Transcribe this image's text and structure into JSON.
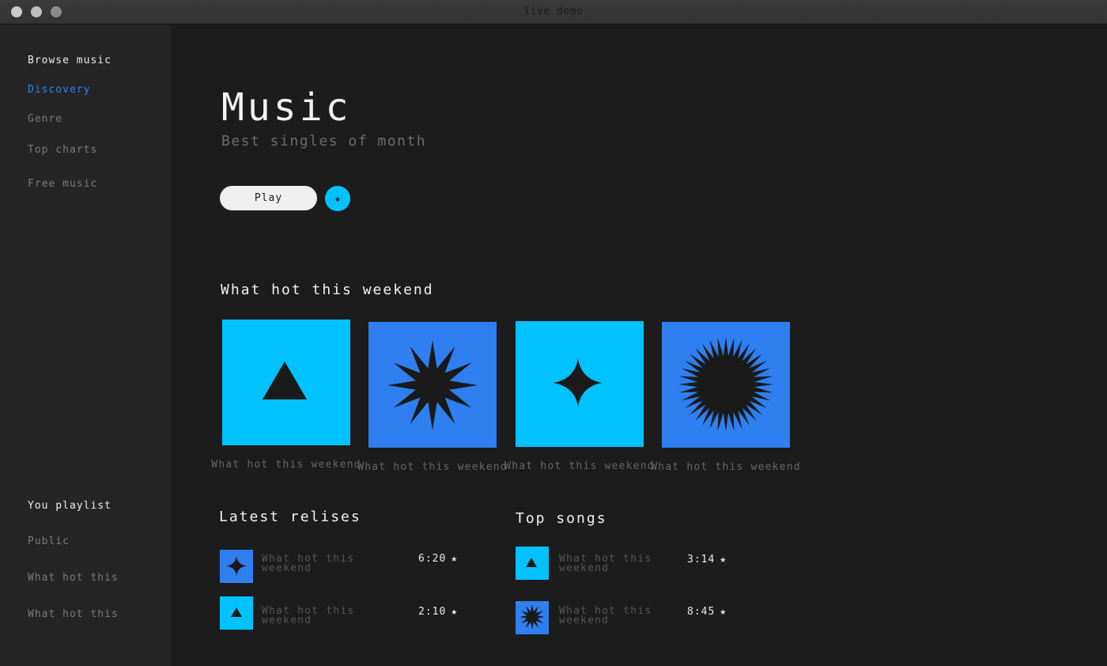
{
  "window": {
    "title": "live demo"
  },
  "colors": {
    "accent_cyan": "#00c2ff",
    "accent_blue": "#2f7ff0",
    "background": "#1c1c1d",
    "sidebar": "#252526",
    "shape": "#1a1a1a"
  },
  "sidebar": {
    "browse_heading": "Browse music",
    "browse_items": [
      {
        "label": "Discovery",
        "active": true
      },
      {
        "label": "Genre"
      },
      {
        "label": "Top charts"
      },
      {
        "label": "Free music"
      }
    ],
    "playlist_heading": "You playlist",
    "playlist_items": [
      {
        "label": "Public"
      },
      {
        "label": "What hot this"
      },
      {
        "label": "What hot this"
      }
    ]
  },
  "header": {
    "title": "Music",
    "subtitle": "Best singles of month",
    "play_label": "Play",
    "fav_icon": "star-icon",
    "fav_glyph": "★"
  },
  "weekend": {
    "title": "What hot this weekend",
    "cards": [
      {
        "label": "What hot this weekend",
        "color": "#00c2ff",
        "icon": "triangle-icon"
      },
      {
        "label": "What hot this weekend",
        "color": "#2f7ff0",
        "icon": "star-burst-icon"
      },
      {
        "label": "What hot this weekend",
        "color": "#00c2ff",
        "icon": "four-point-star-icon"
      },
      {
        "label": "What hot this weekend",
        "color": "#2f7ff0",
        "icon": "sunburst-icon"
      }
    ]
  },
  "latest": {
    "title": "Latest relises",
    "rows": [
      {
        "label": "What hot this weekend",
        "time": "6:20",
        "star": "★",
        "color": "#2f7ff0",
        "icon": "four-point-star-icon"
      },
      {
        "label": "What hot this weekend",
        "time": "2:10",
        "star": "★",
        "color": "#00c2ff",
        "icon": "triangle-icon"
      }
    ]
  },
  "top_songs": {
    "title": "Top songs",
    "rows": [
      {
        "label": "What hot this weekend",
        "time": "3:14",
        "star": "★",
        "color": "#00c2ff",
        "icon": "triangle-icon"
      },
      {
        "label": "What hot this weekend",
        "time": "8:45",
        "star": "★",
        "color": "#2f7ff0",
        "icon": "star-burst-icon"
      }
    ]
  }
}
